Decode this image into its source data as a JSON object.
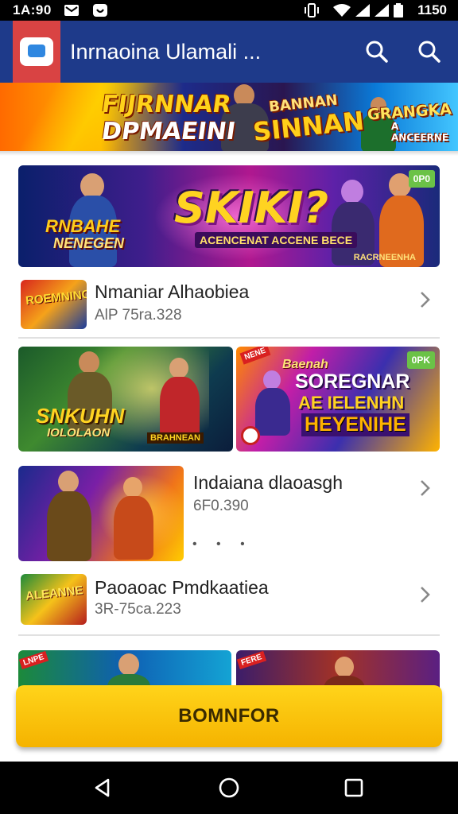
{
  "status_bar": {
    "time": "1A:90",
    "clock": "1150",
    "icons": [
      "mail-icon",
      "app-notification-icon",
      "vibrate-icon",
      "wifi-icon",
      "signal-icon",
      "signal-icon",
      "battery-icon"
    ]
  },
  "app_bar": {
    "title": "Inrnaoina Ulamali ...",
    "logo_icon": "app-logo-icon",
    "actions": [
      "search-icon",
      "search-icon"
    ],
    "color": "#1e3a8a"
  },
  "top_banner": {
    "text_a": "FIJRNNAR",
    "text_b": "DPMAEINI",
    "text_c": "BANNAN",
    "text_d": "SINNAN",
    "text_e": "GRANGKA",
    "text_f": "A ANCEERNE"
  },
  "feature_banner_1": {
    "title": "SKIKI?",
    "subtitle": "ACENCENAT ACCENE BECE",
    "left_line_1": "RNBAHE",
    "left_line_2": "NENEGEN",
    "corner": "0P0",
    "footer": "RACRNEENHA"
  },
  "list_items": [
    {
      "title": "Nmaniar Alhaobiea",
      "subtitle": "AlP 75ra.328",
      "thumb_text": "ROEMNING"
    },
    {
      "title": "Indaiana dlaoasgh",
      "subtitle": "6F0.390",
      "thumb_text": ""
    },
    {
      "title": "Paoaoac Pmdkaatiea",
      "subtitle": "3R-75ca.223",
      "thumb_text": "ALEANNE"
    }
  ],
  "banner_pair": {
    "left_title": "SNKUHN",
    "left_subtitle": "IOLOLAON",
    "left_footer": "BRAHNEAN",
    "right_line_1": "Baenah",
    "right_line_2": "SOREGNAR",
    "right_line_3": "AE IELENHN",
    "right_line_4": "HEYENIHE",
    "right_corner": "0PK",
    "right_ribbon": "NENE"
  },
  "pager_dots": "• • •",
  "bottom_ribbons": [
    "LNPE",
    "FERE"
  ],
  "cta_label": "BOMNFOR",
  "nav": [
    "back-icon",
    "home-icon",
    "recents-icon"
  ],
  "colors": {
    "accent": "#ffc20e",
    "app_bar": "#1e3a8a",
    "logo_bg": "#d94343"
  }
}
